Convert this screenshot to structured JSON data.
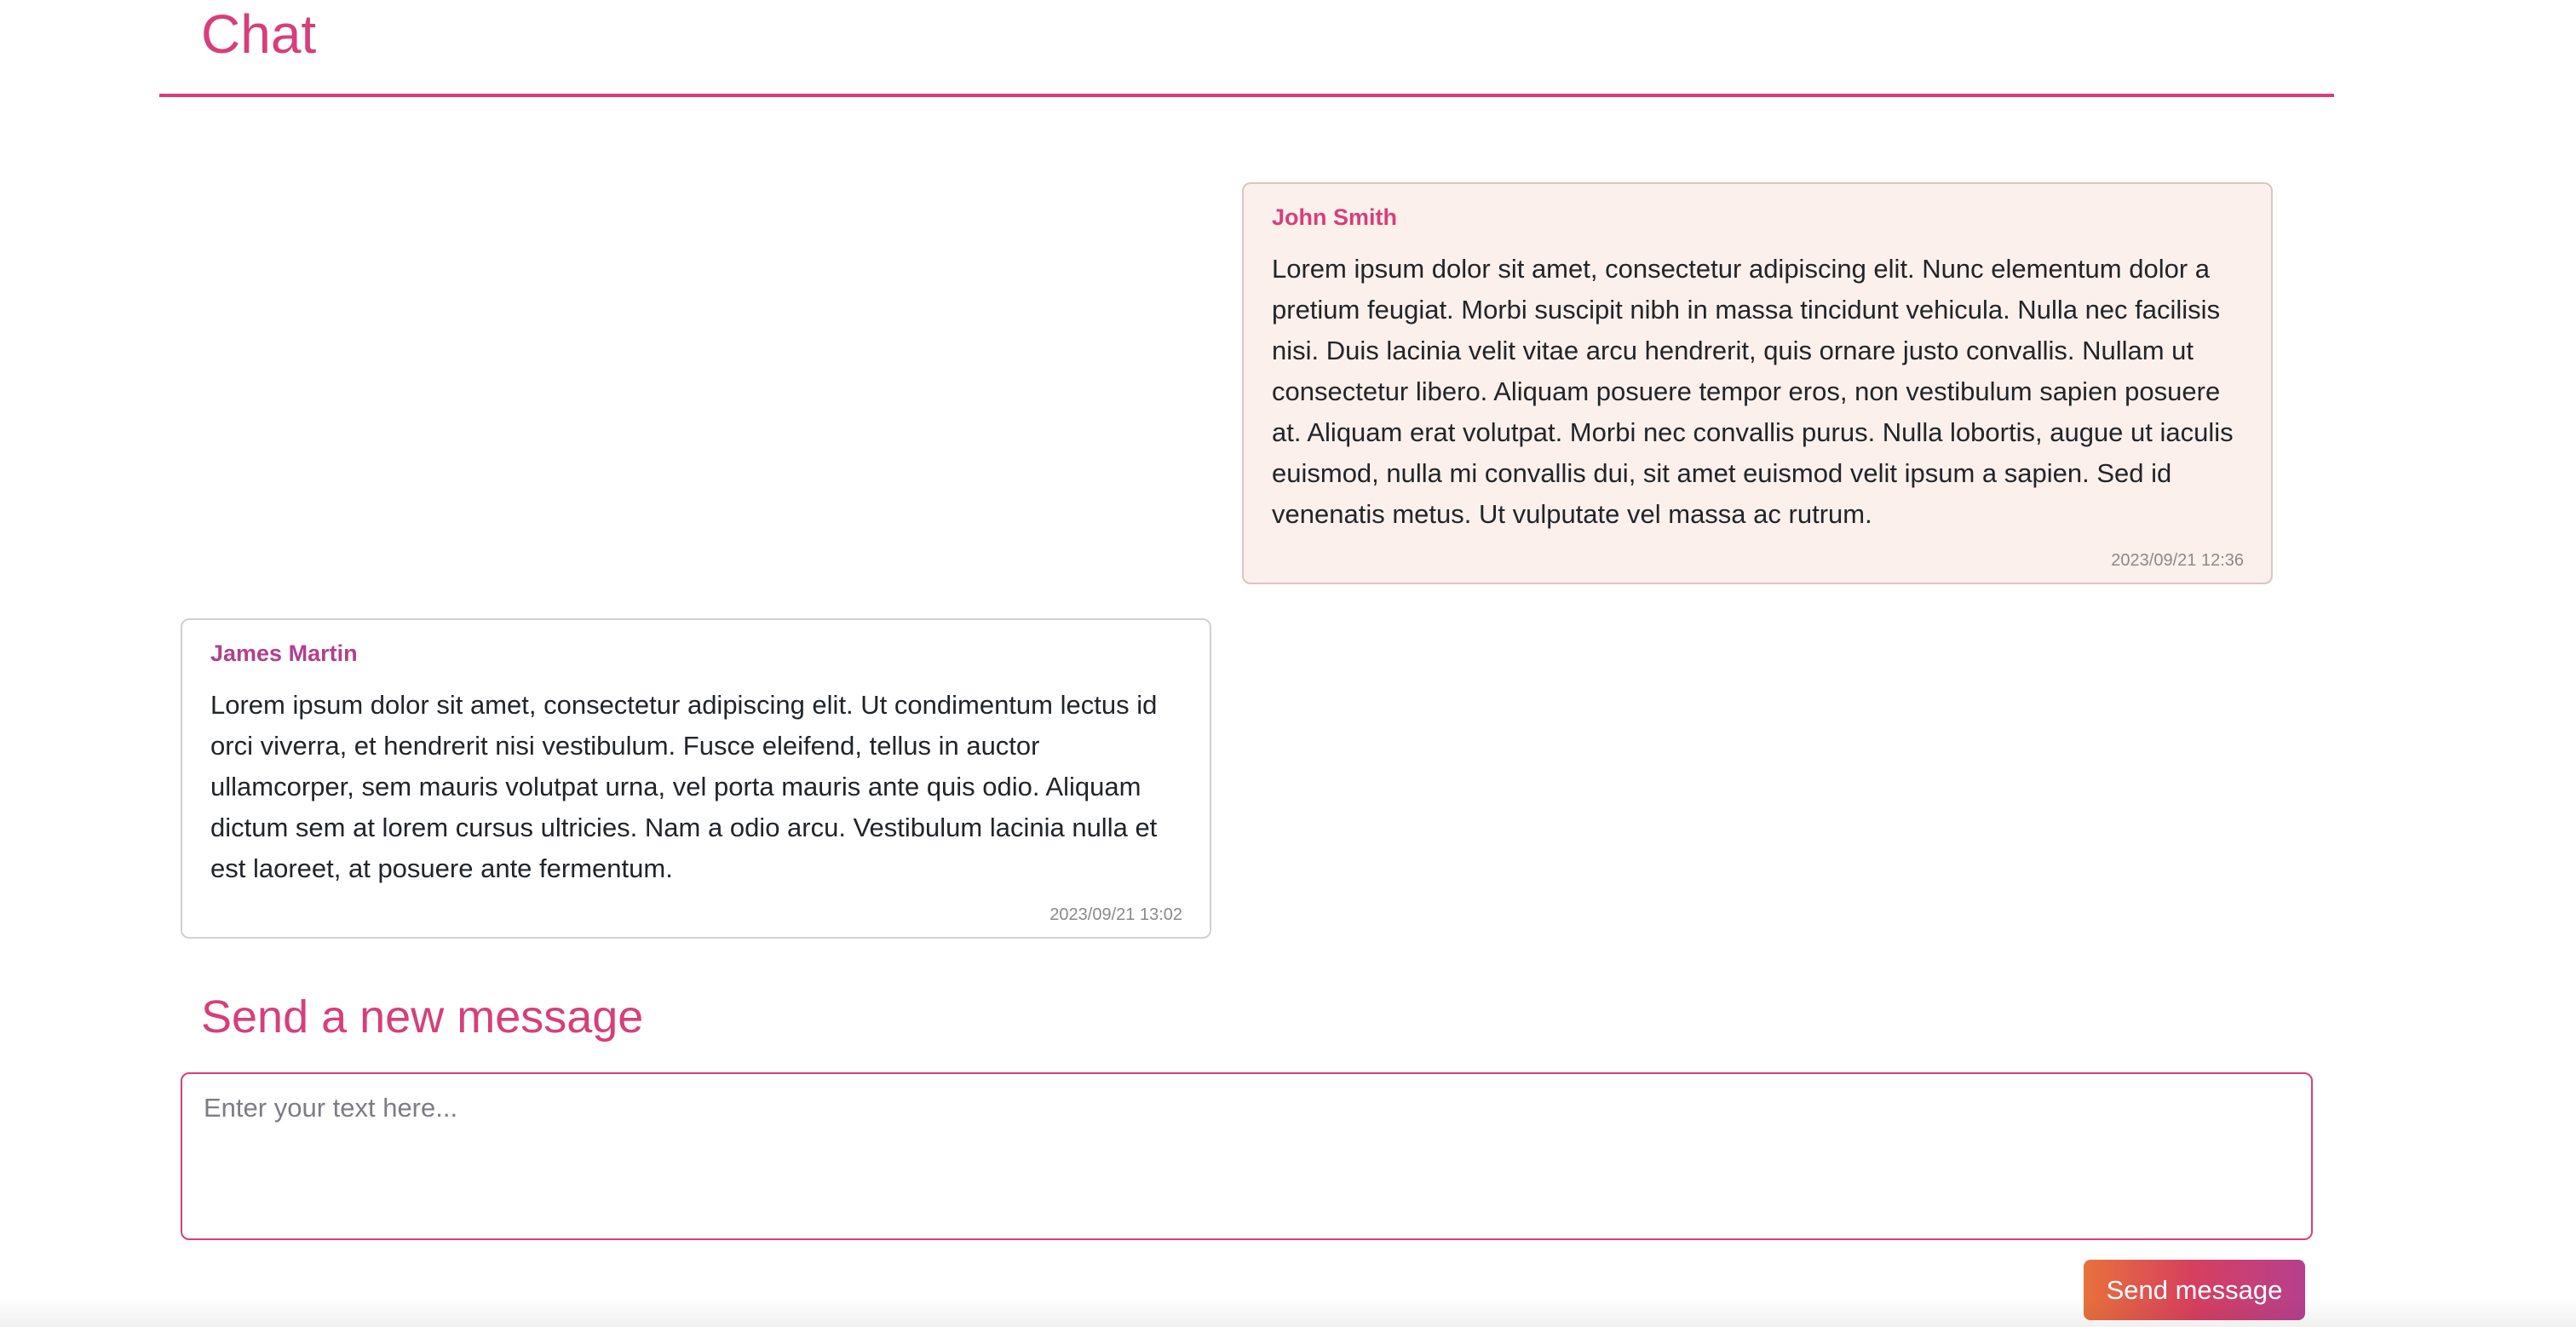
{
  "header": {
    "title": "Chat"
  },
  "messages": [
    {
      "author": "John Smith",
      "body": "Lorem ipsum dolor sit amet, consectetur adipiscing elit. Nunc elementum dolor a pretium feugiat. Morbi suscipit nibh in massa tincidunt vehicula. Nulla nec facilisis nisi. Duis lacinia velit vitae arcu hendrerit, quis ornare justo convallis. Nullam ut consectetur libero. Aliquam posuere tempor eros, non vestibulum sapien posuere at. Aliquam erat volutpat. Morbi nec convallis purus. Nulla lobortis, augue ut iaculis euismod, nulla mi convallis dui, sit amet euismod velit ipsum a sapien. Sed id venenatis metus. Ut vulputate vel massa ac rutrum.",
      "timestamp": "2023/09/21 12:36"
    },
    {
      "author": "James Martin",
      "body": "Lorem ipsum dolor sit amet, consectetur adipiscing elit. Ut condimentum lectus id orci viverra, et hendrerit nisi vestibulum. Fusce eleifend, tellus in auctor ullamcorper, sem mauris volutpat urna, vel porta mauris ante quis odio. Aliquam dictum sem at lorem cursus ultricies. Nam a odio arcu. Vestibulum lacinia nulla et est laoreet, at posuere ante fermentum.",
      "timestamp": "2023/09/21 13:02"
    }
  ],
  "composer": {
    "title": "Send a new message",
    "placeholder": "Enter your text here...",
    "value": "",
    "send_label": "Send message"
  },
  "colors": {
    "accent": "#d63f7a",
    "author_mine": "#d63f7a",
    "author_other": "#b23f8e",
    "button_gradient_start": "#e8713c",
    "button_gradient_mid": "#d63f5f",
    "button_gradient_end": "#b5408f"
  }
}
